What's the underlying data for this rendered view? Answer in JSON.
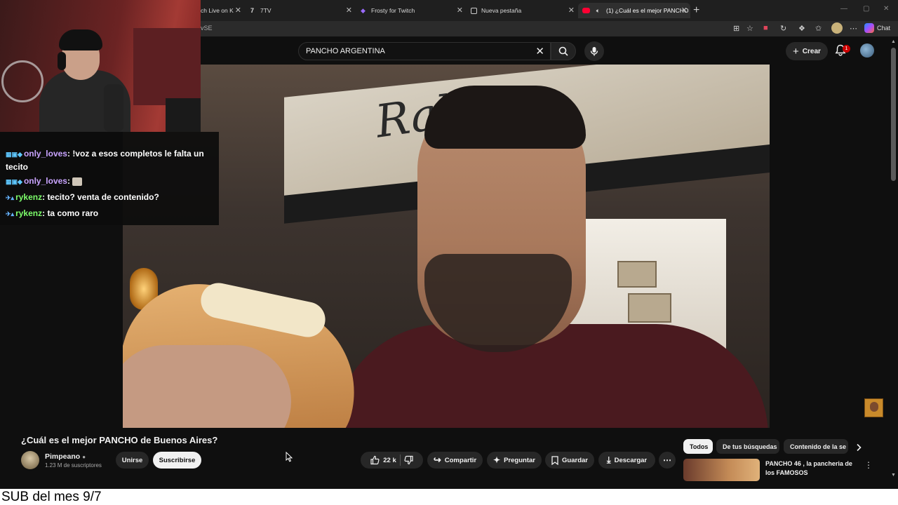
{
  "browser": {
    "tabs": [
      {
        "label": "ch Live on K",
        "icon": "kick-icon"
      },
      {
        "label": "7TV",
        "icon": "seventv-icon"
      },
      {
        "label": "Frosty for Twitch",
        "icon": "frosty-icon"
      },
      {
        "label": "Nueva pestaña",
        "icon": "page-icon"
      },
      {
        "label": "(1) ¿Cuál es el mejor PANCHO",
        "icon": "youtube-icon"
      }
    ],
    "url_fragment": "vSE",
    "chat_label": "Chat"
  },
  "youtube": {
    "search_query": "PANCHO ARGENTINA",
    "create_label": "Crear",
    "notification_count": "1",
    "video_title": "¿Cuál es el mejor PANCHO de Buenos Aires?",
    "video_sign_text": "Rabino",
    "channel": {
      "name": "Pimpeano",
      "subscribers": "1.23 M de suscriptores"
    },
    "join_label": "Unirse",
    "subscribe_label": "Suscribirse",
    "likes": "22 k",
    "share_label": "Compartir",
    "ask_label": "Preguntar",
    "save_label": "Guardar",
    "download_label": "Descargar",
    "chips": [
      "Todos",
      "De tus búsquedas",
      "Contenido de la se"
    ],
    "suggestion_title": "PANCHO 46 , la pancheria de los FAMOSOS"
  },
  "stream_chat": [
    {
      "user": "only_loves",
      "user_color": "#c9a4ff",
      "message": "!voz a esos completos le falta un tecito"
    },
    {
      "user": "only_loves",
      "user_color": "#c9a4ff",
      "message": ""
    },
    {
      "user": "rykenz",
      "user_color": "#7cfc6a",
      "message": "tecito? venta de contenido?"
    },
    {
      "user": "rykenz",
      "user_color": "#7cfc6a",
      "message": "ta como raro"
    }
  ],
  "sub_banner": "SUB del mes 9/7",
  "colors": {
    "youtube_red": "#ff0033",
    "background": "#0f0f0f",
    "chip_active": "#f1f1f1"
  }
}
